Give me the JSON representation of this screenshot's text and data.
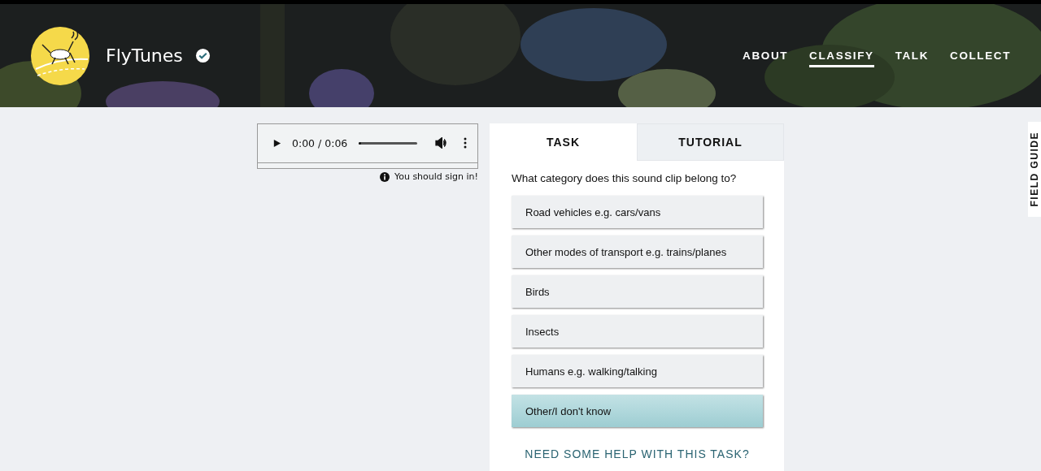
{
  "project": {
    "title": "FlyTunes"
  },
  "nav": [
    {
      "label": "ABOUT",
      "selected": false
    },
    {
      "label": "CLASSIFY",
      "selected": true
    },
    {
      "label": "TALK",
      "selected": false
    },
    {
      "label": "COLLECT",
      "selected": false
    }
  ],
  "player": {
    "time": "0:00 / 0:06",
    "level": 0,
    "notice": "You should sign in!"
  },
  "tabs": [
    {
      "label": "TASK",
      "selected": true
    },
    {
      "label": "TUTORIAL",
      "selected": false
    }
  ],
  "question": "What category does this sound clip belong to?",
  "answers": [
    {
      "label": "Road vehicles e.g. cars/vans",
      "selected": false
    },
    {
      "label": "Other modes of transport e.g. trains/planes",
      "selected": false
    },
    {
      "label": "Birds",
      "selected": false
    },
    {
      "label": "Insects",
      "selected": false
    },
    {
      "label": "Humans e.g. walking/talking",
      "selected": false
    },
    {
      "label": "Other/I don't know",
      "selected": true
    }
  ],
  "help_link": "NEED SOME HELP WITH THIS TASK?",
  "field_guide": "FIELD GUIDE"
}
